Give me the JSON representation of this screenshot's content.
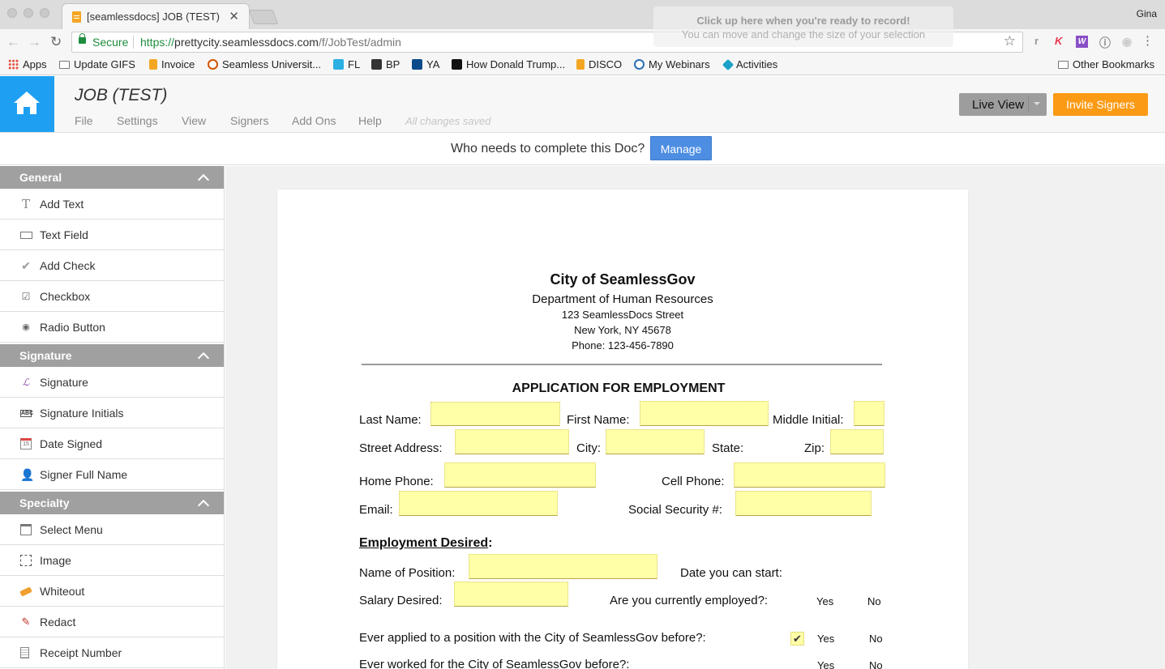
{
  "browser": {
    "tab_title": "[seamlessdocs] JOB (TEST) - a",
    "user": "Gina",
    "secure_label": "Secure",
    "url_https": "https://",
    "url_host": "prettycity.seamlessdocs.com",
    "url_path": "/f/JobTest/admin",
    "recorder_line1": "Click up here when you're ready to record!",
    "recorder_line2": "You can move and change the size of your selection",
    "bookmarks": [
      "Apps",
      "Update GIFS",
      "Invoice",
      "Seamless Universit...",
      "FL",
      "BP",
      "YA",
      "How Donald Trump...",
      "DISCO",
      "My Webinars",
      "Activities"
    ],
    "other_bookmarks": "Other Bookmarks",
    "ext_icons": [
      "r",
      "K",
      "W",
      "info-icon",
      "shield-icon"
    ]
  },
  "app": {
    "doc_title": "JOB (TEST)",
    "menu": [
      "File",
      "Settings",
      "View",
      "Signers",
      "Add Ons",
      "Help"
    ],
    "saved_status": "All changes saved",
    "live_view": "Live View",
    "invite_signers": "Invite Signers",
    "manage_question": "Who needs to complete this Doc?",
    "manage_button": "Manage",
    "colors": {
      "home": "#1e9ff2",
      "invite": "#fb9a14",
      "manage": "#4d8ee3",
      "section": "#a0a0a0"
    }
  },
  "sidebar": {
    "sections": [
      {
        "title": "General",
        "tools": [
          {
            "label": "Add Text",
            "icon": "text-icon"
          },
          {
            "label": "Text Field",
            "icon": "text-field-icon"
          },
          {
            "label": "Add Check",
            "icon": "check-icon"
          },
          {
            "label": "Checkbox",
            "icon": "checkbox-icon"
          },
          {
            "label": "Radio Button",
            "icon": "radio-icon"
          }
        ]
      },
      {
        "title": "Signature",
        "tools": [
          {
            "label": "Signature",
            "icon": "signature-icon"
          },
          {
            "label": "Signature Initials",
            "icon": "initials-icon"
          },
          {
            "label": "Date Signed",
            "icon": "calendar-icon"
          },
          {
            "label": "Signer Full Name",
            "icon": "person-icon"
          }
        ]
      },
      {
        "title": "Specialty",
        "tools": [
          {
            "label": "Select Menu",
            "icon": "select-menu-icon"
          },
          {
            "label": "Image",
            "icon": "image-icon"
          },
          {
            "label": "Whiteout",
            "icon": "eraser-icon"
          },
          {
            "label": "Redact",
            "icon": "redact-icon"
          },
          {
            "label": "Receipt Number",
            "icon": "receipt-icon"
          }
        ]
      }
    ]
  },
  "document": {
    "org": "City of SeamlessGov",
    "dept": "Department of Human Resources",
    "street": "123 SeamlessDocs Street",
    "city": "New York, NY 45678",
    "phone": "Phone: 123-456-7890",
    "form_title": "APPLICATION FOR EMPLOYMENT",
    "labels": {
      "last_name": "Last Name:",
      "first_name": "First Name:",
      "middle_initial": "Middle Initial:",
      "street_address": "Street Address:",
      "city": "City:",
      "state": "State:",
      "zip": "Zip:",
      "home_phone": "Home Phone:",
      "cell_phone": "Cell Phone:",
      "email": "Email:",
      "ssn": "Social Security #:",
      "employment_desired": "Employment Desired",
      "emp_colon": ":",
      "position": "Name of Position:",
      "start_date": "Date you can start:",
      "salary": "Salary Desired:",
      "employed": "Are you currently employed?:",
      "applied_before": "Ever applied to a position with the City of SeamlessGov before?:",
      "worked_before": "Ever worked for the City of SeamlessGov before?:"
    },
    "yes": "Yes",
    "no": "No",
    "check_mark": "✔"
  }
}
